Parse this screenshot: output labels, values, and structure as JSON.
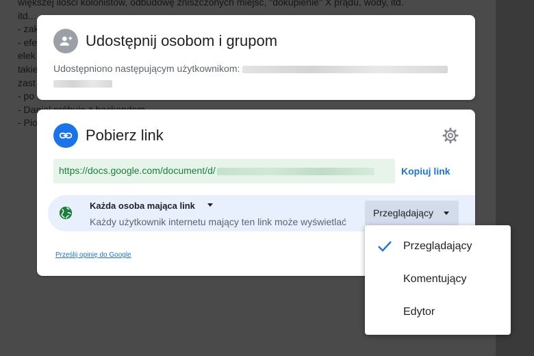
{
  "background_doc": {
    "lines": [
      "większej ilości kolonistów, odbudowę zniszczonych miejsc, \"dokupienie\" X prądu, wody, itd.",
      "itd...",
      "- zak",
      "- efe",
      "elek",
      "takie",
      "zast",
      "- po",
      "- Daniel próbuje z backendem",
      "- Pio"
    ]
  },
  "share_card": {
    "title": "Udostępnij osobom i grupom",
    "shared_with_label": "Udostępniono następującym użytkownikom:",
    "icon": "person-add-icon"
  },
  "link_card": {
    "title": "Pobierz link",
    "icon": "link-icon",
    "settings_icon": "gear-icon",
    "url": "https://docs.google.com/document/d/",
    "copy_link_label": "Kopiuj link",
    "access": {
      "icon": "globe-icon",
      "label": "Każda osoba mająca link",
      "description": "Każdy użytkownik internetu mający ten link może wyświetlać",
      "role_selected": "Przeglądający"
    },
    "feedback_label": "Prześlij opinię do Google"
  },
  "role_menu": {
    "items": [
      {
        "label": "Przeglądający",
        "selected": true
      },
      {
        "label": "Komentujący",
        "selected": false
      },
      {
        "label": "Edytor",
        "selected": false
      }
    ]
  },
  "colors": {
    "accent": "#1a73e8",
    "url_text": "#188038",
    "url_bg": "#e6f4ea",
    "access_bg": "#e8f0fe",
    "overlay": "#4a4a4a"
  }
}
